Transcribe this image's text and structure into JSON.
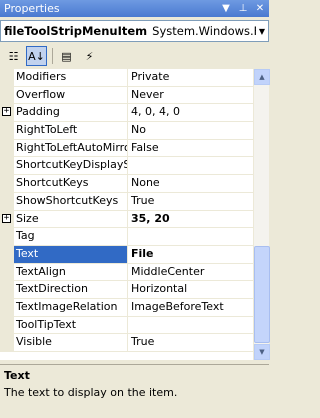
{
  "window": {
    "title": "Properties"
  },
  "object_selector": {
    "name": "fileToolStripMenuItem",
    "type": "System.Windows.Forms."
  },
  "toolbar": {
    "buttons": [
      {
        "name": "categorized-icon",
        "glyph": "☷",
        "active": false
      },
      {
        "name": "alphabetical-icon",
        "glyph": "A↓",
        "active": true
      },
      {
        "name": "properties-icon",
        "glyph": "▤",
        "active": false
      },
      {
        "name": "events-icon",
        "glyph": "⚡",
        "active": false
      }
    ]
  },
  "properties": [
    {
      "name": "Modifiers",
      "value": "Private",
      "expandable": false,
      "bold": false,
      "selected": false
    },
    {
      "name": "Overflow",
      "value": "Never",
      "expandable": false,
      "bold": false,
      "selected": false
    },
    {
      "name": "Padding",
      "value": "4, 0, 4, 0",
      "expandable": true,
      "bold": false,
      "selected": false
    },
    {
      "name": "RightToLeft",
      "value": "No",
      "expandable": false,
      "bold": false,
      "selected": false
    },
    {
      "name": "RightToLeftAutoMirror",
      "value": "False",
      "expandable": false,
      "bold": false,
      "selected": false
    },
    {
      "name": "ShortcutKeyDisplayStri",
      "value": "",
      "expandable": false,
      "bold": false,
      "selected": false
    },
    {
      "name": "ShortcutKeys",
      "value": "None",
      "expandable": false,
      "bold": false,
      "selected": false
    },
    {
      "name": "ShowShortcutKeys",
      "value": "True",
      "expandable": false,
      "bold": false,
      "selected": false
    },
    {
      "name": "Size",
      "value": "35, 20",
      "expandable": true,
      "bold": true,
      "selected": false
    },
    {
      "name": "Tag",
      "value": "",
      "expandable": false,
      "bold": false,
      "selected": false
    },
    {
      "name": "Text",
      "value": "File",
      "expandable": false,
      "bold": true,
      "selected": true
    },
    {
      "name": "TextAlign",
      "value": "MiddleCenter",
      "expandable": false,
      "bold": false,
      "selected": false
    },
    {
      "name": "TextDirection",
      "value": "Horizontal",
      "expandable": false,
      "bold": false,
      "selected": false
    },
    {
      "name": "TextImageRelation",
      "value": "ImageBeforeText",
      "expandable": false,
      "bold": false,
      "selected": false
    },
    {
      "name": "ToolTipText",
      "value": "",
      "expandable": false,
      "bold": false,
      "selected": false
    },
    {
      "name": "Visible",
      "value": "True",
      "expandable": false,
      "bold": false,
      "selected": false
    }
  ],
  "description": {
    "title": "Text",
    "text": "The text to display on the item."
  }
}
